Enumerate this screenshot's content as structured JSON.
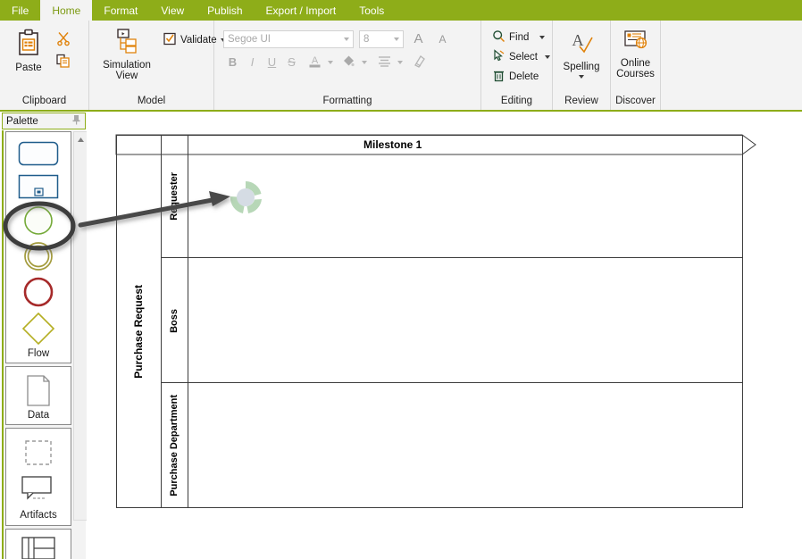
{
  "menu": {
    "tabs": [
      {
        "label": "File",
        "active": false
      },
      {
        "label": "Home",
        "active": true
      },
      {
        "label": "Format",
        "active": false
      },
      {
        "label": "View",
        "active": false
      },
      {
        "label": "Publish",
        "active": false
      },
      {
        "label": "Export / Import",
        "active": false
      },
      {
        "label": "Tools",
        "active": false
      }
    ],
    "accent_color": "#8ead19"
  },
  "ribbon": {
    "groups": {
      "clipboard": {
        "label": "Clipboard",
        "paste_label": "Paste",
        "cut_icon": "scissors-icon",
        "copy_icon": "copy-icon",
        "paste_icon": "clipboard-icon"
      },
      "model": {
        "label": "Model",
        "simulation_label": "Simulation",
        "simulation_label2": "View",
        "simulation_icon": "hierarchy-icon",
        "validate_label": "Validate",
        "validate_icon": "checkbox-checked-icon"
      },
      "formatting": {
        "label": "Formatting",
        "font_name": "Segoe UI",
        "font_size": "8",
        "grow_font": "A",
        "shrink_font": "A",
        "bold": "B",
        "italic": "I",
        "underline": "U",
        "strikethrough": "S",
        "font_color": "A",
        "fill_color": "fill-icon",
        "align": "align-icon",
        "format_painter": "format-painter-icon"
      },
      "editing": {
        "label": "Editing",
        "find_label": "Find",
        "select_label": "Select",
        "delete_label": "Delete",
        "find_icon": "search-icon",
        "select_icon": "cursor-icon",
        "delete_icon": "trash-icon"
      },
      "review": {
        "label": "Review",
        "spelling_label": "Spelling",
        "spelling_icon": "spellcheck-icon"
      },
      "discover": {
        "label": "Discover",
        "online_label": "Online",
        "online_label2": "Courses",
        "online_icon": "online-courses-icon"
      }
    }
  },
  "palette": {
    "title": "Palette",
    "pin_icon": "pin-icon",
    "scroll_up_icon": "scroll-up-arrow-icon",
    "sections": [
      {
        "label": "Flow",
        "items": [
          {
            "name": "task-shape",
            "shape": "rounded-rect",
            "color": "#1f5c8b"
          },
          {
            "name": "subprocess-shape",
            "shape": "rect-with-marker",
            "color": "#1f5c8b"
          },
          {
            "name": "start-event-shape",
            "shape": "circle",
            "color": "#74a938",
            "selected": true
          },
          {
            "name": "intermediate-event-shape",
            "shape": "double-circle",
            "color": "#a39b3c"
          },
          {
            "name": "end-event-shape",
            "shape": "circle",
            "color": "#a62a2a"
          },
          {
            "name": "gateway-shape",
            "shape": "diamond",
            "color": "#b4ae22"
          }
        ]
      },
      {
        "label": "Data",
        "items": [
          {
            "name": "data-object-shape",
            "shape": "document",
            "color": "#808080"
          }
        ]
      },
      {
        "label": "Artifacts",
        "items": [
          {
            "name": "group-shape",
            "shape": "dashed-rect",
            "color": "#909090"
          },
          {
            "name": "annotation-shape",
            "shape": "callout",
            "color": "#3c3c3c"
          }
        ]
      },
      {
        "label": "",
        "items": [
          {
            "name": "pool-shape",
            "shape": "pool-table",
            "color": "#3c3c3c"
          }
        ]
      }
    ]
  },
  "diagram": {
    "milestone": {
      "label": "Milestone 1"
    },
    "pool": {
      "label": "Purchase Request"
    },
    "lanes": [
      {
        "label": "Requester",
        "height": 137
      },
      {
        "label": "Boss",
        "height": 140
      },
      {
        "label": "Purchase Department",
        "height": 140
      }
    ],
    "drop_indicator": {
      "name": "drop-target-indicator",
      "inner_color": "#d2d9e2",
      "arc_color": "#9ccb9c"
    },
    "annotation": {
      "arrow_color": "#4a4a4a",
      "highlight_color": "#3c3c3c"
    }
  }
}
